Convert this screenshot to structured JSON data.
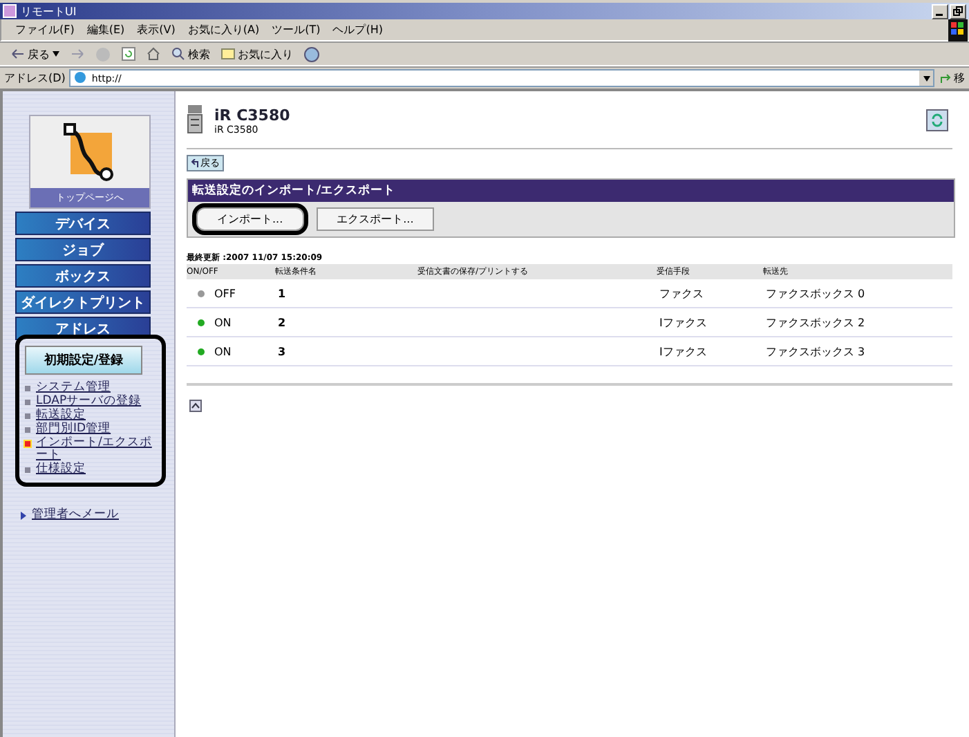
{
  "window": {
    "title": "リモートUI"
  },
  "menu": [
    "ファイル(F)",
    "編集(E)",
    "表示(V)",
    "お気に入り(A)",
    "ツール(T)",
    "ヘルプ(H)"
  ],
  "toolbar": {
    "back": "戻る",
    "search": "検索",
    "favorites": "お気に入り"
  },
  "address": {
    "label": "アドレス(D)",
    "value": "http://",
    "go": "移"
  },
  "sidebar": {
    "top_link": "トップページへ",
    "nav": [
      "デバイス",
      "ジョブ",
      "ボックス",
      "ダイレクトプリント",
      "アドレス"
    ],
    "section": {
      "title": "初期設定/登録",
      "highlighted": true,
      "items": [
        {
          "label": "システム管理",
          "selected": false
        },
        {
          "label": "LDAPサーバの登録",
          "selected": false
        },
        {
          "label": "転送設定",
          "selected": false
        },
        {
          "label": "部門別ID管理",
          "selected": false
        },
        {
          "label": "インポート/エクスポート",
          "selected": true
        },
        {
          "label": "仕様設定",
          "selected": false
        }
      ]
    },
    "mail": "管理者へメール"
  },
  "device": {
    "name": "iR C3580",
    "model": "iR C3580"
  },
  "back_button": "戻る",
  "panel": {
    "title": "転送設定のインポート/エクスポート",
    "buttons": [
      {
        "label": "インポート...",
        "highlighted": true
      },
      {
        "label": "エクスポート...",
        "highlighted": false
      }
    ]
  },
  "last_updated": "最終更新 :2007 11/07 15:20:09",
  "table": {
    "columns": [
      "ON/OFF",
      "転送条件名",
      "受信文書の保存/プリントする",
      "受信手段",
      "転送先"
    ],
    "rows": [
      {
        "on": false,
        "status": "OFF",
        "name": "1",
        "method": "ファクス",
        "destination": "ファクスボックス 0"
      },
      {
        "on": true,
        "status": "ON",
        "name": "2",
        "method": "Iファクス",
        "destination": "ファクスボックス 2"
      },
      {
        "on": true,
        "status": "ON",
        "name": "3",
        "method": "Iファクス",
        "destination": "ファクスボックス 3"
      }
    ]
  }
}
